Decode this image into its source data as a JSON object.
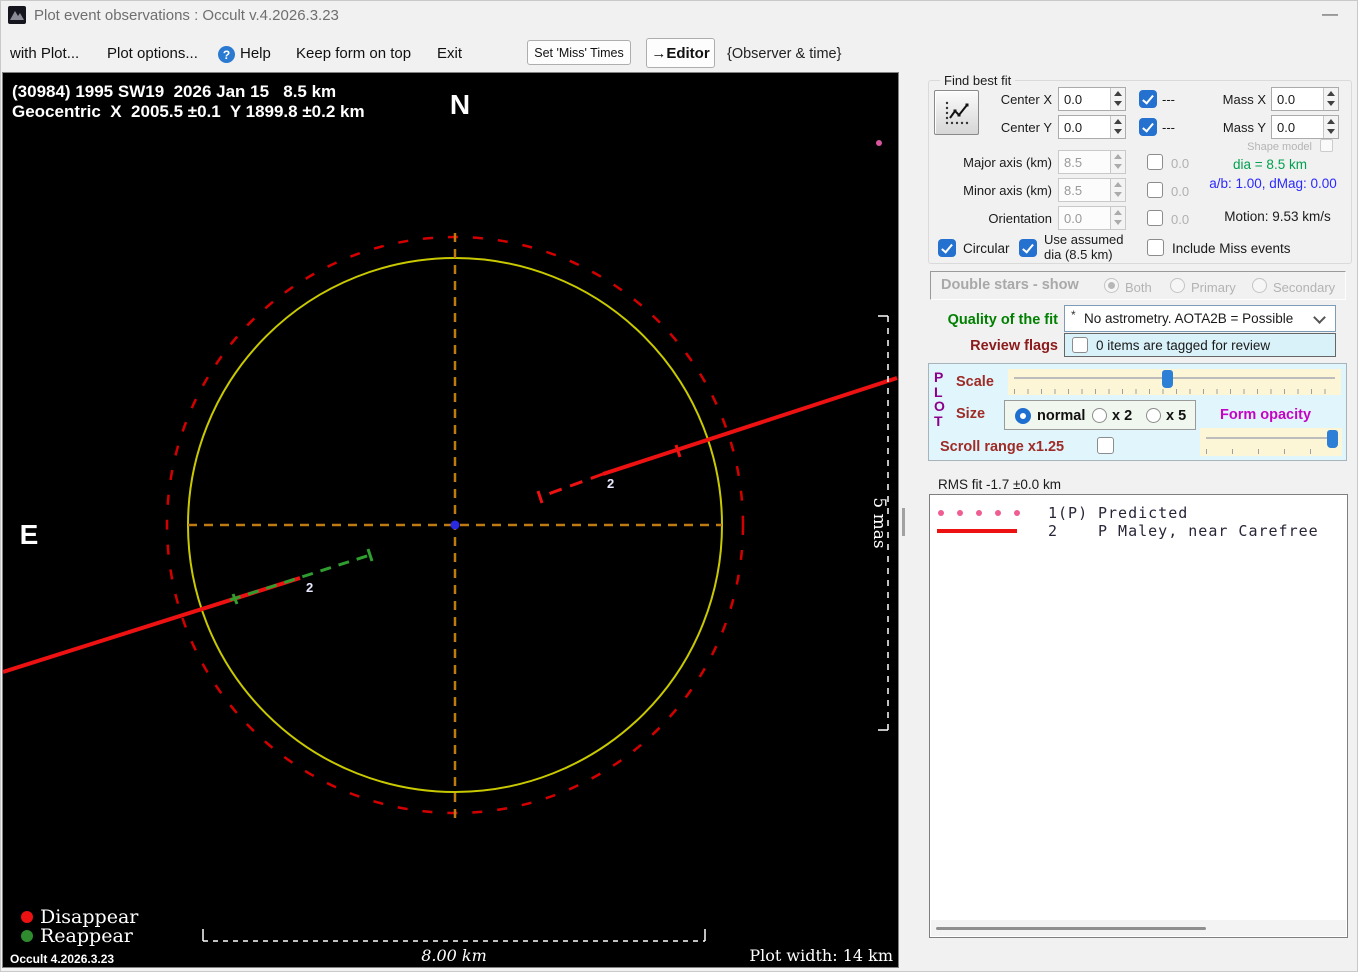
{
  "window": {
    "title": "Plot event observations : Occult v.4.2026.3.23",
    "minimize_glyph": "—"
  },
  "menubar": {
    "items": [
      {
        "label": "with Plot..."
      },
      {
        "label": "Plot options..."
      },
      {
        "label": "Help"
      },
      {
        "label": "Keep form on top"
      },
      {
        "label": "Exit"
      }
    ],
    "help_icon_glyph": "?",
    "set_miss_times_button": "Set 'Miss' Times",
    "editor_button": "→Editor",
    "observer_time_label": "{Observer & time}"
  },
  "plot": {
    "header_line1": "(30984) 1995 SW19  2026 Jan 15   8.5 km",
    "header_line2": "Geocentric  X  2005.5 ±0.1  Y 1899.8 ±0.2 km",
    "north_label": "N",
    "east_label": "E",
    "chord_label": "2",
    "mas_scale_label": "5 mas",
    "scale_bar_label": "8.00 km",
    "plot_width_label": "Plot width: 14 km",
    "legend_disappear": "Disappear",
    "legend_reappear": "Reappear",
    "version_label": "Occult 4.2026.3.23",
    "colors": {
      "asteroid_outline": "#c9c900",
      "uncertainty_circle": "#d40000",
      "crosshair": "#bf7b11",
      "chord_red": "#ee1111",
      "reappear_green": "#2f9e2f",
      "center_dot": "#2a2ae0"
    }
  },
  "find_best_fit": {
    "title": "Find best fit",
    "center_x_label": "Center X",
    "center_x_value": "0.0",
    "center_x_dashes": "---",
    "center_y_label": "Center Y",
    "center_y_value": "0.0",
    "center_y_dashes": "---",
    "mass_x_label": "Mass X",
    "mass_x_value": "0.0",
    "mass_y_label": "Mass Y",
    "mass_y_value": "0.0",
    "shape_model_label": "Shape model",
    "major_axis_label": "Major axis (km)",
    "major_axis_value": "8.5",
    "major_axis_flag": "0.0",
    "minor_axis_label": "Minor axis (km)",
    "minor_axis_value": "8.5",
    "minor_axis_flag": "0.0",
    "orientation_label": "Orientation",
    "orientation_value": "0.0",
    "orientation_flag": "0.0",
    "dia_text": "dia = 8.5 km",
    "ab_dmag_text": "a/b: 1.00, dMag: 0.00",
    "motion_text": "Motion: 9.53 km/s",
    "circular_label": "Circular",
    "use_assumed_line1": "Use assumed",
    "use_assumed_line2": "dia (8.5 km)",
    "include_miss_label": "Include Miss events"
  },
  "double_stars": {
    "label": "Double stars - show",
    "options": [
      "Both",
      "Primary",
      "Secondary"
    ],
    "selected": "Both"
  },
  "quality_fit": {
    "label": "Quality of the fit",
    "star": "*",
    "value": "No astrometry. AOTA2B = Possible"
  },
  "review_flags": {
    "label": "Review flags",
    "text": "0 items are tagged for review"
  },
  "plot_controls": {
    "plot_letters": [
      "P",
      "L",
      "O",
      "T"
    ],
    "scale_label": "Scale",
    "scale_slider_percent": 48,
    "size_label": "Size",
    "size_options": [
      "normal",
      "x 2",
      "x 5"
    ],
    "size_selected": "normal",
    "form_opacity_label": "Form opacity",
    "opacity_slider_percent": 94,
    "scroll_range_label": "Scroll range x1.25"
  },
  "rms_fit_label": "RMS fit -1.7 ±0.0 km",
  "legend_list": {
    "rows": [
      {
        "swatch": "dotted-pink",
        "col1": "1(P)",
        "col2": "Predicted"
      },
      {
        "swatch": "solid-red",
        "col1": "2",
        "col2": "P Maley, near Carefree"
      }
    ]
  }
}
